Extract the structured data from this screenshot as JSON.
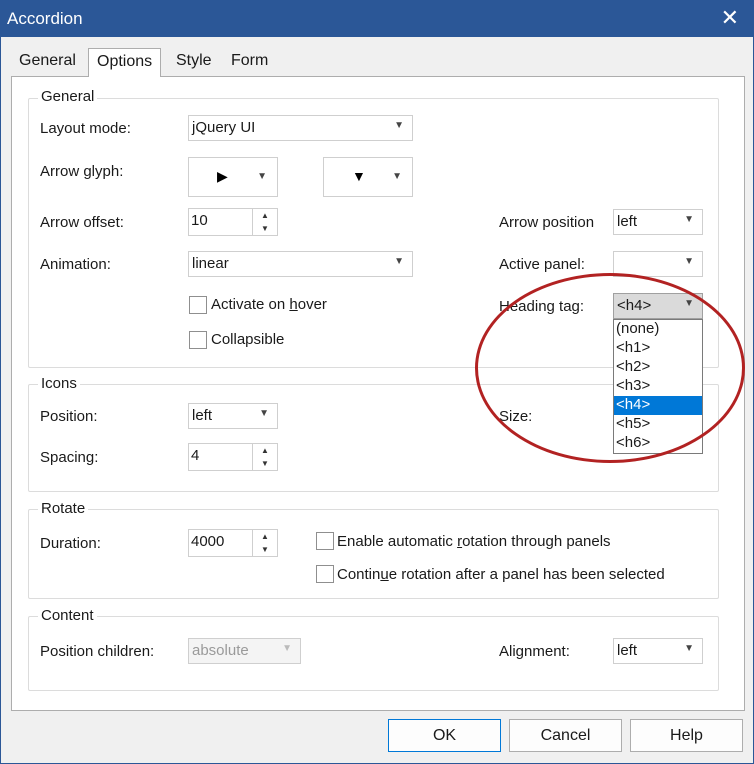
{
  "window": {
    "title": "Accordion",
    "close_glyph": "✕"
  },
  "tabs": [
    {
      "label": "General"
    },
    {
      "label": "Options"
    },
    {
      "label": "Style"
    },
    {
      "label": "Form"
    }
  ],
  "general": {
    "title": "General",
    "layout_mode_label": "Layout mode:",
    "layout_mode_value": "jQuery UI",
    "arrow_glyph_label": "Arrow glyph:",
    "arrow_glyph_collapsed": "▶",
    "arrow_glyph_expanded": "▼",
    "arrow_offset_label": "Arrow offset:",
    "arrow_offset_value": "10",
    "animation_label": "Animation:",
    "animation_value": "linear",
    "activate_on_hover_pre": "Activate on ",
    "activate_on_hover_key": "h",
    "activate_on_hover_post": "over",
    "collapsible_label": "Collapsible",
    "arrow_position_label": "Arrow position",
    "arrow_position_value": "left",
    "active_panel_label": "Active panel:",
    "active_panel_value": "",
    "heading_tag_label": "Heading tag:",
    "heading_tag_value": "<h4>",
    "heading_tag_options": [
      "(none)",
      "<h1>",
      "<h2>",
      "<h3>",
      "<h4>",
      "<h5>",
      "<h6>"
    ],
    "heading_tag_selected_index": 4
  },
  "icons": {
    "title": "Icons",
    "position_label": "Position:",
    "position_value": "left",
    "spacing_label": "Spacing:",
    "spacing_value": "4",
    "size_label": "Size:"
  },
  "rotate": {
    "title": "Rotate",
    "duration_label": "Duration:",
    "duration_value": "4000",
    "auto_rotation_pre": "Enable automatic ",
    "auto_rotation_key": "r",
    "auto_rotation_post": "otation through panels",
    "continue_rotation_pre": "Contin",
    "continue_rotation_key": "u",
    "continue_rotation_post": "e rotation after a panel has been selected"
  },
  "content": {
    "title": "Content",
    "position_children_label": "Position children:",
    "position_children_value": "absolute",
    "alignment_label": "Alignment:",
    "alignment_value": "left"
  },
  "buttons": {
    "ok": "OK",
    "cancel": "Cancel",
    "help": "Help"
  },
  "icons_glyphs": {
    "dropdown_arrow": "▼",
    "spin_up": "▲",
    "spin_down": "▼"
  },
  "colors": {
    "titlebar": "#2b5797",
    "selection": "#0078d7",
    "annotation": "#b22222"
  }
}
